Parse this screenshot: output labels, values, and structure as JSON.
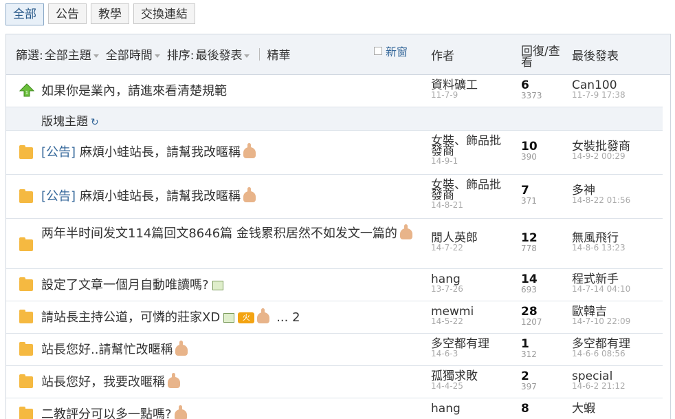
{
  "tabs": [
    "全部",
    "公告",
    "教學",
    "交換連結"
  ],
  "header": {
    "filter_label": "篩選:",
    "filter_value": "全部主題",
    "time_value": "全部時間",
    "sort_label": "排序:",
    "sort_value": "最後發表",
    "digest_label": "精華",
    "new_window_label": "新窗",
    "col_author": "作者",
    "col_reply": "回復/查看",
    "col_last": "最後發表"
  },
  "pinned": {
    "title": "如果你是業內，請進來看清楚規範",
    "author": "資料礦工",
    "author_date": "11-7-9",
    "replies": "6",
    "views": "3373",
    "last_user": "Can100",
    "last_time": "11-7-9 17:38"
  },
  "section_title": "版塊主題",
  "threads": [
    {
      "tag": "[公告]",
      "title": "麻煩小蛙站長，請幫我改暱稱",
      "author": "女裝、飾品批發商",
      "author_date": "14-9-1",
      "replies": "10",
      "views": "390",
      "last_user": "女裝批發商",
      "last_time": "14-9-2 00:29"
    },
    {
      "tag": "[公告]",
      "title": "麻煩小蛙站長，請幫我改暱稱",
      "author": "女裝、飾品批發商",
      "author_date": "14-8-21",
      "replies": "7",
      "views": "371",
      "last_user": "多神",
      "last_time": "14-8-22 01:56"
    },
    {
      "tag": "",
      "title": "两年半时间发文114篇回文8646篇 金钱累积居然不如发文一篇的",
      "author": "閒人英郎",
      "author_date": "14-7-22",
      "replies": "12",
      "views": "778",
      "last_user": "無風飛行",
      "last_time": "14-8-6 13:23"
    },
    {
      "tag": "",
      "title": "設定了文章一個月自動唯讀嗎?",
      "author": "hang",
      "author_date": "13-7-26",
      "replies": "14",
      "views": "693",
      "last_user": "程式新手",
      "last_time": "14-7-14 04:10"
    },
    {
      "tag": "",
      "title": "請站長主持公道，可憐的莊家XD",
      "pages": "... 2",
      "author": "mewmi",
      "author_date": "14-5-22",
      "replies": "28",
      "views": "1207",
      "last_user": "歐韓吉",
      "last_time": "14-7-10 22:09"
    },
    {
      "tag": "",
      "title": "站長您好..請幫忙改暱稱",
      "author": "多空都有理",
      "author_date": "14-6-3",
      "replies": "1",
      "views": "312",
      "last_user": "多空都有理",
      "last_time": "14-6-6 08:56"
    },
    {
      "tag": "",
      "title": "站長您好，我要改暱稱",
      "author": "孤獨求敗",
      "author_date": "14-4-25",
      "replies": "2",
      "views": "397",
      "last_user": "special",
      "last_time": "14-6-2 21:12"
    },
    {
      "tag": "",
      "title": "二教評分可以多一點嗎?",
      "author": "hang",
      "author_date": "",
      "replies": "8",
      "views": "",
      "last_user": "大蝦",
      "last_time": ""
    }
  ]
}
